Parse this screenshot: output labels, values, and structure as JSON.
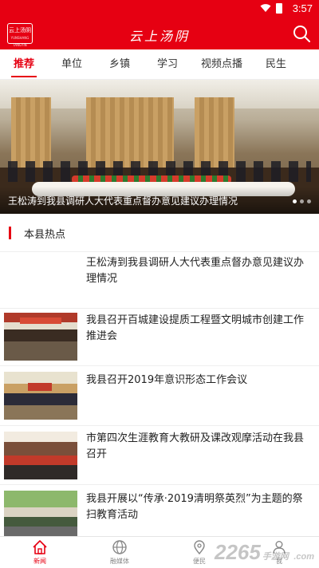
{
  "status_bar": {
    "time": "3:57"
  },
  "app_bar": {
    "logo_text": "云上汤阴",
    "logo_subtext": "YUNSHANG TANGYIN",
    "brand_title": "云上汤阴",
    "search_icon": "search-icon"
  },
  "tabs": [
    "推荐",
    "单位",
    "乡镇",
    "学习",
    "视频点播",
    "民生"
  ],
  "active_tab": 0,
  "banner": {
    "caption": "王松涛到我县调研人大代表重点督办意见建议办理情况",
    "slide_count": 3,
    "active_slide": 1
  },
  "section": {
    "title": "本县热点"
  },
  "news": [
    {
      "title": "王松涛到我县调研人大代表重点督办意见建议办理情况",
      "has_image": false
    },
    {
      "title": "我县召开百城建设提质工程暨文明城市创建工作推进会",
      "has_image": true
    },
    {
      "title": "我县召开2019年意识形态工作会议",
      "has_image": true
    },
    {
      "title": "市第四次生涯教育大教研及课改观摩活动在我县召开",
      "has_image": true
    },
    {
      "title": "我县开展以“传承·2019清明祭英烈”为主题的祭扫教育活动",
      "has_image": true
    }
  ],
  "bottom_nav": [
    {
      "label": "新闻",
      "icon": "home-icon",
      "active": true
    },
    {
      "label": "融媒体",
      "icon": "globe-icon",
      "active": false
    },
    {
      "label": "便民",
      "icon": "location-icon",
      "active": false
    },
    {
      "label": "我",
      "icon": "person-icon",
      "active": false
    }
  ],
  "watermark": {
    "number": "2265",
    "suffix": "手游网",
    "domain": ".com"
  },
  "colors": {
    "brand_red": "#e60012"
  }
}
